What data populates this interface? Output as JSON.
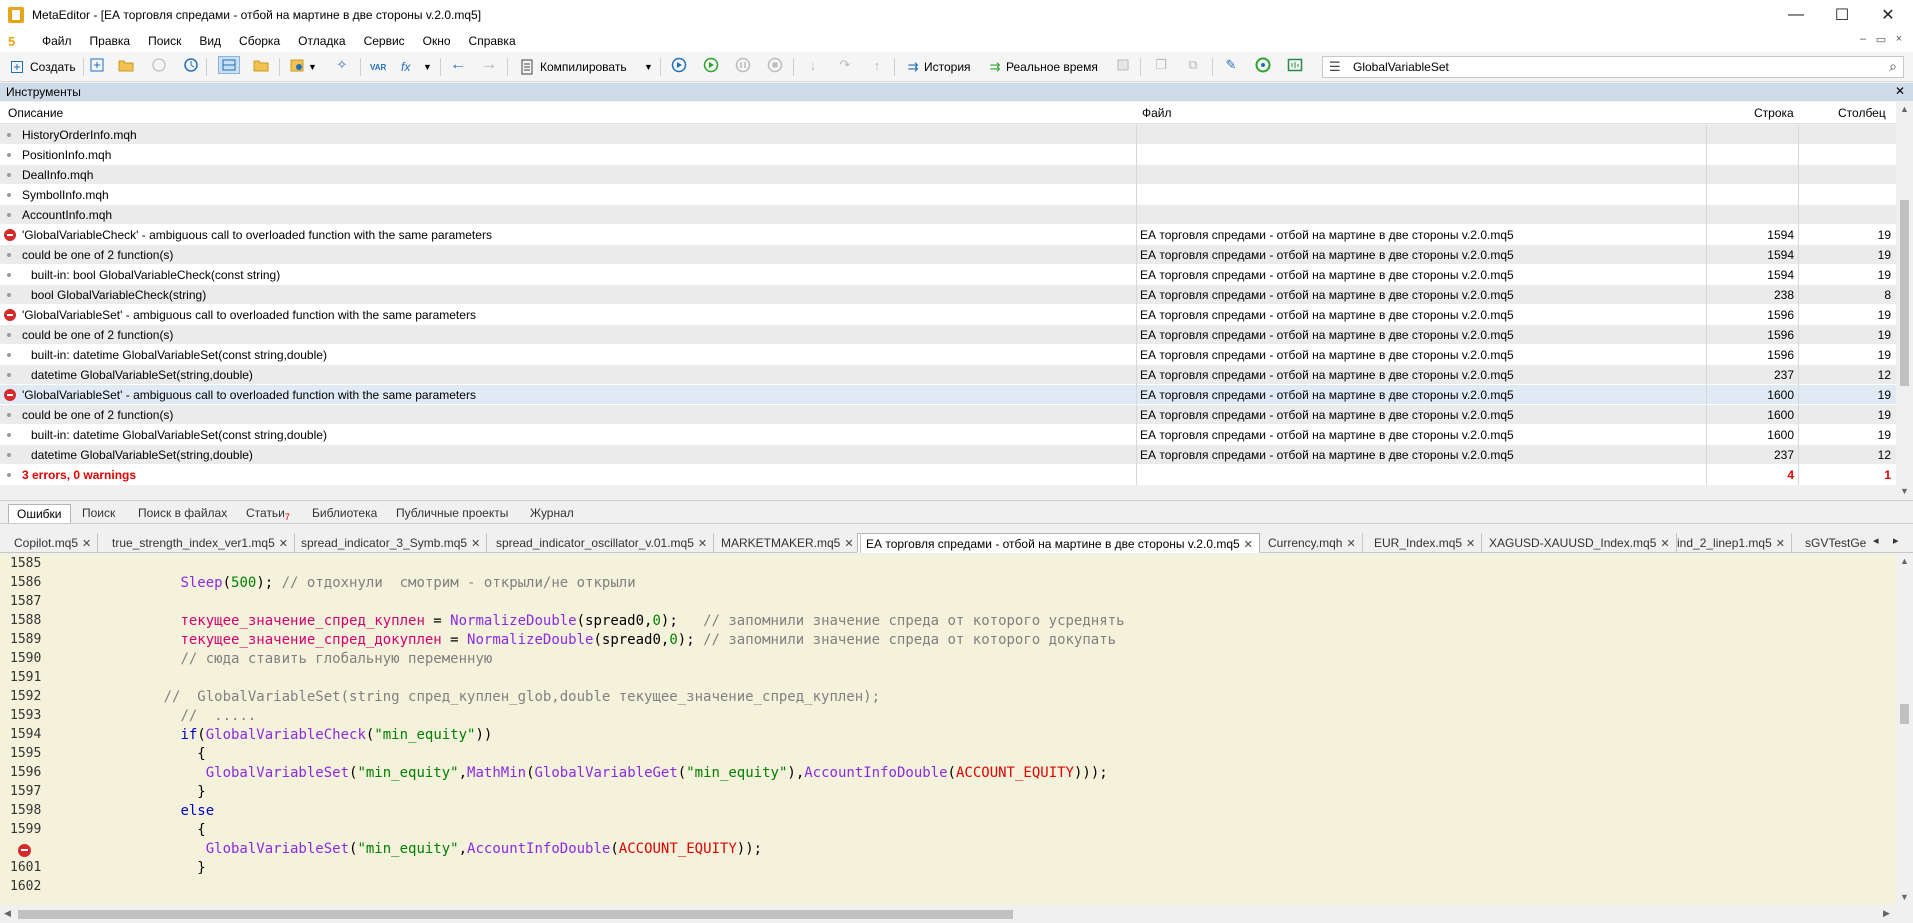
{
  "window": {
    "title": "MetaEditor - [ЕА торговля спредами - отбой на мартине в две стороны v.2.0.mq5]",
    "minimize": "—",
    "maximize": "☐",
    "close": "✕"
  },
  "menu": {
    "logo": "5",
    "items": [
      "Файл",
      "Правка",
      "Поиск",
      "Вид",
      "Сборка",
      "Отладка",
      "Сервис",
      "Окно",
      "Справка"
    ],
    "mdi_min": "–",
    "mdi_restore": "▭",
    "mdi_close": "×"
  },
  "toolbar": {
    "create": "Создать",
    "compile": "Компилировать",
    "history": "История",
    "realtime": "Реальное время",
    "search_value": "GlobalVariableSet",
    "var_label": "VAR",
    "fx_label": "fx"
  },
  "tools_panel": {
    "title": "Инструменты",
    "close": "✕",
    "columns": [
      "Описание",
      "Файл",
      "Строка",
      "Столбец"
    ],
    "rows": [
      {
        "type": "dot",
        "desc": "HistoryOrderInfo.mqh",
        "file": "",
        "line": "",
        "col": ""
      },
      {
        "type": "dot",
        "desc": "PositionInfo.mqh",
        "file": "",
        "line": "",
        "col": ""
      },
      {
        "type": "dot",
        "desc": "DealInfo.mqh",
        "file": "",
        "line": "",
        "col": ""
      },
      {
        "type": "dot",
        "desc": "SymbolInfo.mqh",
        "file": "",
        "line": "",
        "col": ""
      },
      {
        "type": "dot",
        "desc": "AccountInfo.mqh",
        "file": "",
        "line": "",
        "col": ""
      },
      {
        "type": "error",
        "desc": "'GlobalVariableCheck' - ambiguous call to overloaded function with the same parameters",
        "file": "ЕА торговля спредами - отбой на мартине в две стороны v.2.0.mq5",
        "line": "1594",
        "col": "19"
      },
      {
        "type": "dot",
        "desc": "could be one of 2 function(s)",
        "file": "ЕА торговля спредами - отбой на мартине в две стороны v.2.0.mq5",
        "line": "1594",
        "col": "19"
      },
      {
        "type": "dot",
        "indent": true,
        "desc": "built-in: bool GlobalVariableCheck(const string)",
        "file": "ЕА торговля спредами - отбой на мартине в две стороны v.2.0.mq5",
        "line": "1594",
        "col": "19"
      },
      {
        "type": "dot",
        "indent": true,
        "desc": "bool GlobalVariableCheck(string)",
        "file": "ЕА торговля спредами - отбой на мартине в две стороны v.2.0.mq5",
        "line": "238",
        "col": "8"
      },
      {
        "type": "error",
        "desc": "'GlobalVariableSet' - ambiguous call to overloaded function with the same parameters",
        "file": "ЕА торговля спредами - отбой на мартине в две стороны v.2.0.mq5",
        "line": "1596",
        "col": "19"
      },
      {
        "type": "dot",
        "desc": "could be one of 2 function(s)",
        "file": "ЕА торговля спредами - отбой на мартине в две стороны v.2.0.mq5",
        "line": "1596",
        "col": "19"
      },
      {
        "type": "dot",
        "indent": true,
        "desc": "built-in: datetime GlobalVariableSet(const string,double)",
        "file": "ЕА торговля спредами - отбой на мартине в две стороны v.2.0.mq5",
        "line": "1596",
        "col": "19"
      },
      {
        "type": "dot",
        "indent": true,
        "desc": "datetime GlobalVariableSet(string,double)",
        "file": "ЕА торговля спредами - отбой на мартине в две стороны v.2.0.mq5",
        "line": "237",
        "col": "12"
      },
      {
        "type": "error",
        "selected": true,
        "desc": "'GlobalVariableSet' - ambiguous call to overloaded function with the same parameters",
        "file": "ЕА торговля спредами - отбой на мартине в две стороны v.2.0.mq5",
        "line": "1600",
        "col": "19"
      },
      {
        "type": "dot",
        "desc": "could be one of 2 function(s)",
        "file": "ЕА торговля спредами - отбой на мартине в две стороны v.2.0.mq5",
        "line": "1600",
        "col": "19"
      },
      {
        "type": "dot",
        "indent": true,
        "desc": "built-in: datetime GlobalVariableSet(const string,double)",
        "file": "ЕА торговля спредами - отбой на мартине в две стороны v.2.0.mq5",
        "line": "1600",
        "col": "19"
      },
      {
        "type": "dot",
        "indent": true,
        "desc": "datetime GlobalVariableSet(string,double)",
        "file": "ЕА торговля спредами - отбой на мартине в две стороны v.2.0.mq5",
        "line": "237",
        "col": "12"
      },
      {
        "type": "summary",
        "desc": "3 errors, 0 warnings",
        "file": "",
        "line": "4",
        "col": "1"
      }
    ]
  },
  "bottom_tabs": [
    {
      "label": "Ошибки",
      "active": true
    },
    {
      "label": "Поиск"
    },
    {
      "label": "Поиск в файлах"
    },
    {
      "label": "Статьи",
      "badge": "7"
    },
    {
      "label": "Библиотека"
    },
    {
      "label": "Публичные проекты"
    },
    {
      "label": "Журнал"
    }
  ],
  "editor_tabs": [
    {
      "label": "Copilot.mq5"
    },
    {
      "label": "true_strength_index_ver1.mq5"
    },
    {
      "label": "spread_indicator_3_Symb.mq5"
    },
    {
      "label": "spread_indicator_oscillator_v.01.mq5"
    },
    {
      "label": "MARKETMAKER.mq5"
    },
    {
      "label": "ЕА торговля спредами - отбой на мартине в две стороны v.2.0.mq5",
      "active": true
    },
    {
      "label": "Currency.mqh"
    },
    {
      "label": "EUR_Index.mq5"
    },
    {
      "label": "XAGUSD-XAUUSD_Index.mq5"
    },
    {
      "label": "ind_2_linep1.mq5"
    },
    {
      "label": "sGVTestGe"
    }
  ],
  "code_lines": [
    {
      "n": "1585",
      "tokens": []
    },
    {
      "n": "1586",
      "tokens": [
        [
          "pl",
          "               "
        ],
        [
          "fn",
          "Sleep"
        ],
        [
          "pl",
          "("
        ],
        [
          "str",
          "500"
        ],
        [
          "pl",
          "); "
        ],
        [
          "cmt",
          "// отдохнули  смотрим - открыли/не открыли"
        ]
      ]
    },
    {
      "n": "1587",
      "tokens": []
    },
    {
      "n": "1588",
      "tokens": [
        [
          "pl",
          "               "
        ],
        [
          "var",
          "текущее_значение_спред_куплен"
        ],
        [
          "pl",
          " = "
        ],
        [
          "fn",
          "NormalizeDouble"
        ],
        [
          "pl",
          "(spread0,"
        ],
        [
          "str",
          "0"
        ],
        [
          "pl",
          ");   "
        ],
        [
          "cmt",
          "// запомнили значение спреда от которого усреднять"
        ]
      ]
    },
    {
      "n": "1589",
      "tokens": [
        [
          "pl",
          "               "
        ],
        [
          "var",
          "текущее_значение_спред_докуплен"
        ],
        [
          "pl",
          " = "
        ],
        [
          "fn",
          "NormalizeDouble"
        ],
        [
          "pl",
          "(spread0,"
        ],
        [
          "str",
          "0"
        ],
        [
          "pl",
          "); "
        ],
        [
          "cmt",
          "// запомнили значение спреда от которого докупать"
        ]
      ]
    },
    {
      "n": "1590",
      "tokens": [
        [
          "pl",
          "               "
        ],
        [
          "cmt",
          "// сюда ставить глобальную переменную"
        ]
      ]
    },
    {
      "n": "1591",
      "tokens": []
    },
    {
      "n": "1592",
      "tokens": [
        [
          "pl",
          "             "
        ],
        [
          "cmt",
          "//  GlobalVariableSet(string спред_куплен_glob,double текущее_значение_спред_куплен);"
        ]
      ]
    },
    {
      "n": "1593",
      "tokens": [
        [
          "pl",
          "               "
        ],
        [
          "cmt",
          "//  ....."
        ]
      ]
    },
    {
      "n": "1594",
      "tokens": [
        [
          "pl",
          "               "
        ],
        [
          "kw",
          "if"
        ],
        [
          "pl",
          "("
        ],
        [
          "fn",
          "GlobalVariableCheck"
        ],
        [
          "pl",
          "("
        ],
        [
          "str",
          "\"min_equity\""
        ],
        [
          "pl",
          "))"
        ]
      ]
    },
    {
      "n": "1595",
      "tokens": [
        [
          "pl",
          "                 {"
        ]
      ]
    },
    {
      "n": "1596",
      "tokens": [
        [
          "pl",
          "                  "
        ],
        [
          "fn",
          "GlobalVariableSet"
        ],
        [
          "pl",
          "("
        ],
        [
          "str",
          "\"min_equity\""
        ],
        [
          "pl",
          ","
        ],
        [
          "fn",
          "MathMin"
        ],
        [
          "pl",
          "("
        ],
        [
          "fn",
          "GlobalVariableGet"
        ],
        [
          "pl",
          "("
        ],
        [
          "str",
          "\"min_equity\""
        ],
        [
          "pl",
          "),"
        ],
        [
          "fn",
          "AccountInfoDouble"
        ],
        [
          "pl",
          "("
        ],
        [
          "cst",
          "ACCOUNT_EQUITY"
        ],
        [
          "pl",
          ")));"
        ]
      ]
    },
    {
      "n": "1597",
      "tokens": [
        [
          "pl",
          "                 }"
        ]
      ]
    },
    {
      "n": "1598",
      "tokens": [
        [
          "pl",
          "               "
        ],
        [
          "kw",
          "else"
        ]
      ]
    },
    {
      "n": "1599",
      "tokens": [
        [
          "pl",
          "                 {"
        ]
      ]
    },
    {
      "n": "1600",
      "err": true,
      "tokens": [
        [
          "pl",
          "                  "
        ],
        [
          "fn",
          "GlobalVariableSet"
        ],
        [
          "pl",
          "("
        ],
        [
          "str",
          "\"min_equity\""
        ],
        [
          "pl",
          ","
        ],
        [
          "fn",
          "AccountInfoDouble"
        ],
        [
          "pl",
          "("
        ],
        [
          "cst",
          "ACCOUNT_EQUITY"
        ],
        [
          "pl",
          "));"
        ]
      ]
    },
    {
      "n": "1601",
      "tokens": [
        [
          "pl",
          "                 }"
        ]
      ]
    },
    {
      "n": "1602",
      "tokens": []
    }
  ]
}
